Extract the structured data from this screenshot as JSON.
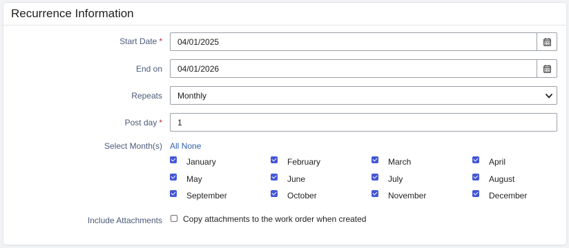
{
  "panel": {
    "title": "Recurrence Information"
  },
  "fields": {
    "start_date": {
      "label": "Start Date",
      "required_mark": "*",
      "value": "04/01/2025",
      "calendar_icon": "calendar-icon"
    },
    "end_on": {
      "label": "End on",
      "value": "04/01/2026",
      "calendar_icon": "calendar-icon"
    },
    "repeats": {
      "label": "Repeats",
      "value": "Monthly",
      "dropdown_icon": "chevron-down-icon"
    },
    "post_day": {
      "label": "Post day",
      "required_mark": "*",
      "value": "1"
    }
  },
  "months": {
    "label": "Select Month(s)",
    "select_all": "All",
    "select_none": "None",
    "items": [
      {
        "name": "January",
        "checked": true
      },
      {
        "name": "February",
        "checked": true
      },
      {
        "name": "March",
        "checked": true
      },
      {
        "name": "April",
        "checked": true
      },
      {
        "name": "May",
        "checked": true
      },
      {
        "name": "June",
        "checked": true
      },
      {
        "name": "July",
        "checked": true
      },
      {
        "name": "August",
        "checked": true
      },
      {
        "name": "September",
        "checked": true
      },
      {
        "name": "October",
        "checked": true
      },
      {
        "name": "November",
        "checked": true
      },
      {
        "name": "December",
        "checked": true
      }
    ]
  },
  "attachments": {
    "label": "Include Attachments",
    "option_text": "Copy attachments to the work order when created",
    "checked": false
  },
  "colors": {
    "accent": "#4356d6",
    "link": "#2f5fa8",
    "required": "#c0283a",
    "label": "#4a5a78"
  }
}
